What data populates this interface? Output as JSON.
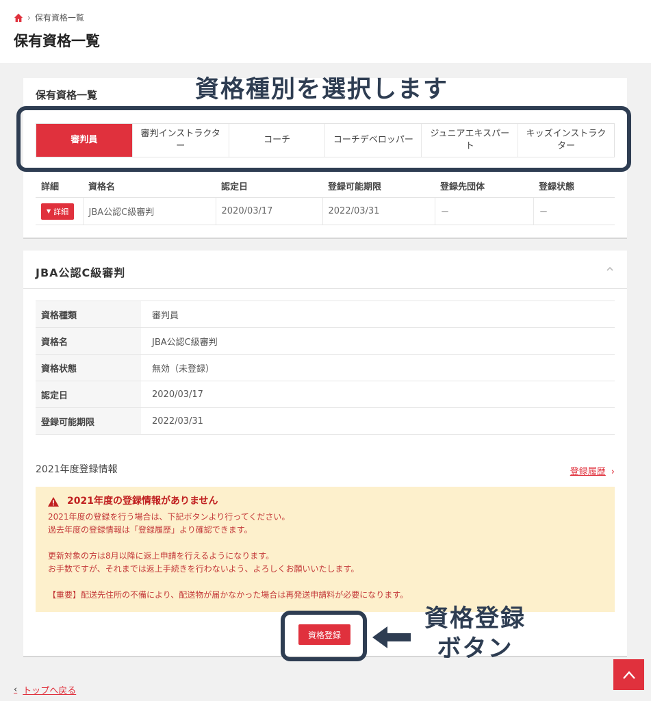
{
  "breadcrumb": {
    "home_icon": "home-icon",
    "current": "保有資格一覧"
  },
  "page_title": "保有資格一覧",
  "qualifications": {
    "section_title": "保有資格一覧",
    "tabs": [
      {
        "label": "審判員",
        "active": true
      },
      {
        "label": "審判インストラクター",
        "active": false
      },
      {
        "label": "コーチ",
        "active": false
      },
      {
        "label": "コーチデベロッパー",
        "active": false
      },
      {
        "label": "ジュニアエキスパート",
        "active": false
      },
      {
        "label": "キッズインストラクター",
        "active": false
      }
    ],
    "columns": [
      "詳細",
      "資格名",
      "認定日",
      "登録可能期限",
      "登録先団体",
      "登録状態"
    ],
    "rows": [
      {
        "detail_label": "詳細",
        "name": "JBA公認C級審判",
        "certified": "2020/03/17",
        "deadline": "2022/03/31",
        "org": "－",
        "status": "－"
      }
    ]
  },
  "detail": {
    "title": "JBA公認C級審判",
    "fields": [
      {
        "label": "資格種類",
        "value": "審判員"
      },
      {
        "label": "資格名",
        "value": "JBA公認C級審判"
      },
      {
        "label": "資格状態",
        "value": "無効（未登録）"
      },
      {
        "label": "認定日",
        "value": "2020/03/17"
      },
      {
        "label": "登録可能期限",
        "value": "2022/03/31"
      }
    ],
    "year_info_title": "2021年度登録情報",
    "history_link": "登録履歴",
    "notice": {
      "title": "2021年度の登録情報がありません",
      "line1": "2021年度の登録を行う場合は、下記ボタンより行ってください。",
      "line2": "過去年度の登録情報は「登録履歴」より確認できます。",
      "line3": "更新対象の方は8月以降に返上申請を行えるようになります。",
      "line4": "お手数ですが、それまでは返上手続きを行わないよう、よろしくお願いいたします。",
      "line5": "【重要】配送先住所の不備により、配送物が届かなかった場合は再発送申請料が必要になります。"
    },
    "register_button": "資格登録"
  },
  "footer": {
    "back_link": "トップへ戻る"
  },
  "annotations": {
    "tabs_caption": "資格種別を選択します",
    "button_caption_line1": "資格登録",
    "button_caption_line2": "ボタン"
  },
  "colors": {
    "accent": "#e0313d",
    "annotation": "#2e3d52",
    "notice_bg": "#fdf0cc"
  }
}
